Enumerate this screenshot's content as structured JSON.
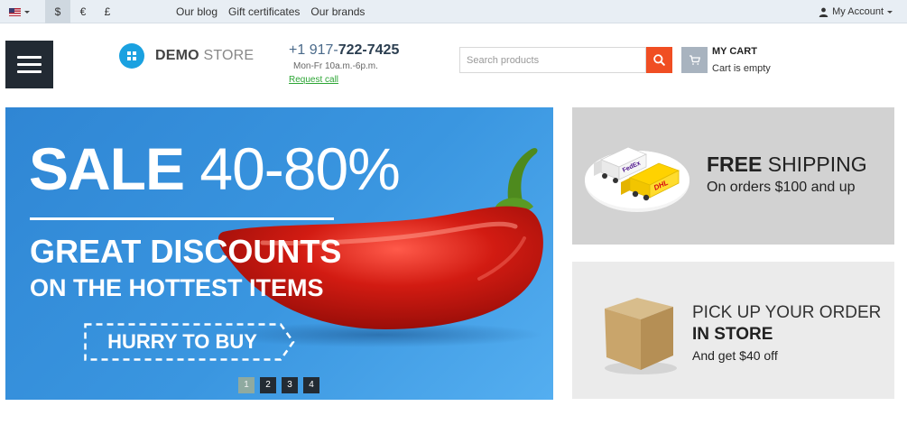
{
  "topbar": {
    "currencies": [
      "$",
      "€",
      "£"
    ],
    "active_currency": "$",
    "links": [
      "Our blog",
      "Gift certificates",
      "Our brands"
    ],
    "account_label": "My Account"
  },
  "header": {
    "logo_bold": "DEMO",
    "logo_light": "STORE",
    "phone_prefix": "+1 917-",
    "phone_main": "722-7425",
    "hours": "Mon-Fr 10a.m.-6p.m.",
    "request_call": "Request call",
    "search_placeholder": "Search products",
    "cart_title": "MY CART",
    "cart_status": "Cart is empty"
  },
  "banner": {
    "sale_word": "SALE",
    "sale_range": "40-80%",
    "line1": "GREAT DISCOUNTS",
    "line2": "ON THE HOTTEST ITEMS",
    "cta": "HURRY TO BUY",
    "slides": [
      "1",
      "2",
      "3",
      "4"
    ],
    "active_slide": 1
  },
  "promos": {
    "shipping": {
      "title_bold": "FREE",
      "title_light": "SHIPPING",
      "subtitle": "On orders $100 and up",
      "truck_labels": [
        "FedEx",
        "DHL"
      ]
    },
    "pickup": {
      "line1": "PICK UP YOUR ORDER",
      "line2": "IN STORE",
      "line3": "And get $40 off"
    }
  },
  "colors": {
    "topbar_bg": "#e8eef4",
    "accent_search": "#f04e23",
    "banner_blue": "#3a96e0",
    "logo_blue": "#1aa1e0",
    "request_call_green": "#2ea636",
    "menu_dark": "#222a33"
  }
}
